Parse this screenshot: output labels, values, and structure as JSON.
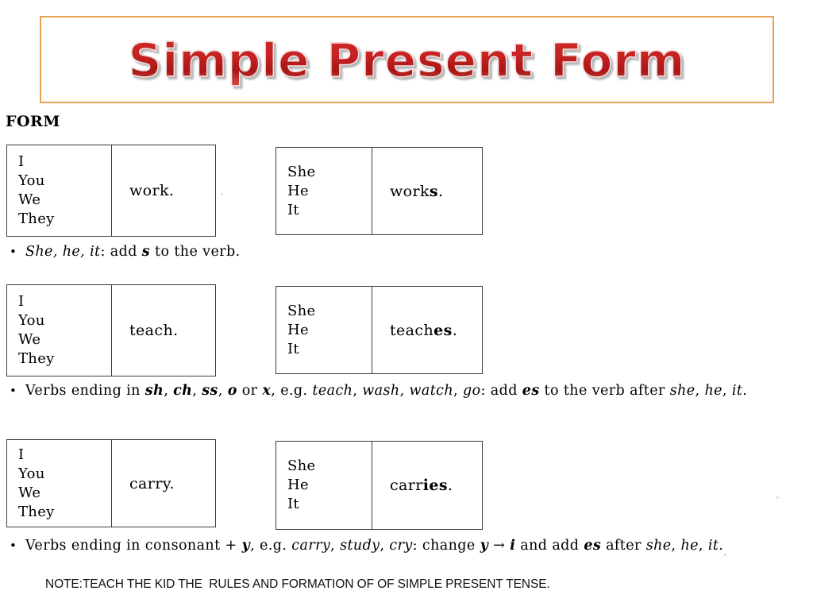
{
  "slide": {
    "title": "Simple Present Form",
    "section_heading": "FORM",
    "accent_border_color": "#e8a055",
    "title_color": "#c62222",
    "background_color": "#ffffff"
  },
  "tables": [
    {
      "left": {
        "pronouns": [
          "I",
          "You",
          "We",
          "They"
        ],
        "verb_stem": "work",
        "verb_inflection": "",
        "verb_period": "."
      },
      "right": {
        "pronouns": [
          "She",
          "He",
          "It"
        ],
        "verb_stem": "work",
        "verb_inflection": "s",
        "verb_period": "."
      }
    },
    {
      "left": {
        "pronouns": [
          "I",
          "You",
          "We",
          "They"
        ],
        "verb_stem": "teach",
        "verb_inflection": "",
        "verb_period": "."
      },
      "right": {
        "pronouns": [
          "She",
          "He",
          "It"
        ],
        "verb_stem": "teach",
        "verb_inflection": "es",
        "verb_period": "."
      }
    },
    {
      "left": {
        "pronouns": [
          "I",
          "You",
          "We",
          "They"
        ],
        "verb_stem": "carry",
        "verb_inflection": "",
        "verb_period": "."
      },
      "right": {
        "pronouns": [
          "She",
          "He",
          "It"
        ],
        "verb_stem": "carr",
        "verb_inflection": "ies",
        "verb_period": "."
      }
    }
  ],
  "rules": [
    {
      "id": "rule-add-s",
      "segments": [
        {
          "text": "She, he, it",
          "style": "italic"
        },
        {
          "text": ": add ",
          "style": "normal"
        },
        {
          "text": "s",
          "style": "bold-italic"
        },
        {
          "text": " to the verb.",
          "style": "normal"
        }
      ]
    },
    {
      "id": "rule-add-es",
      "segments": [
        {
          "text": "Verbs ending in ",
          "style": "normal"
        },
        {
          "text": "sh",
          "style": "bold-italic"
        },
        {
          "text": ", ",
          "style": "normal"
        },
        {
          "text": "ch",
          "style": "bold-italic"
        },
        {
          "text": ", ",
          "style": "normal"
        },
        {
          "text": "ss",
          "style": "bold-italic"
        },
        {
          "text": ", ",
          "style": "normal"
        },
        {
          "text": "o",
          "style": "bold-italic"
        },
        {
          "text": " or ",
          "style": "normal"
        },
        {
          "text": "x",
          "style": "bold-italic"
        },
        {
          "text": ", e.g. ",
          "style": "normal"
        },
        {
          "text": "teach",
          "style": "italic"
        },
        {
          "text": ", ",
          "style": "normal"
        },
        {
          "text": "wash",
          "style": "italic"
        },
        {
          "text": ", ",
          "style": "normal"
        },
        {
          "text": "watch",
          "style": "italic"
        },
        {
          "text": ", ",
          "style": "normal"
        },
        {
          "text": "go",
          "style": "italic"
        },
        {
          "text": ": add ",
          "style": "normal"
        },
        {
          "text": "es",
          "style": "bold-italic"
        },
        {
          "text": " to the verb after ",
          "style": "normal"
        },
        {
          "text": "she",
          "style": "italic"
        },
        {
          "text": ", ",
          "style": "normal"
        },
        {
          "text": "he",
          "style": "italic"
        },
        {
          "text": ", ",
          "style": "normal"
        },
        {
          "text": "it",
          "style": "italic"
        },
        {
          "text": ".",
          "style": "normal"
        }
      ]
    },
    {
      "id": "rule-y-to-i",
      "segments": [
        {
          "text": "Verbs ending in consonant ",
          "style": "normal"
        },
        {
          "text": "+ ",
          "style": "normal"
        },
        {
          "text": "y",
          "style": "bold-italic"
        },
        {
          "text": ", e.g. ",
          "style": "normal"
        },
        {
          "text": "carry",
          "style": "italic"
        },
        {
          "text": ", ",
          "style": "normal"
        },
        {
          "text": "study",
          "style": "italic"
        },
        {
          "text": ", ",
          "style": "normal"
        },
        {
          "text": "cry",
          "style": "italic"
        },
        {
          "text": ": change ",
          "style": "normal"
        },
        {
          "text": "y",
          "style": "bold-italic"
        },
        {
          "text": " → ",
          "style": "normal"
        },
        {
          "text": "i",
          "style": "bold-italic"
        },
        {
          "text": " and add ",
          "style": "normal"
        },
        {
          "text": "es",
          "style": "bold-italic"
        },
        {
          "text": " after ",
          "style": "normal"
        },
        {
          "text": "she",
          "style": "italic"
        },
        {
          "text": ", ",
          "style": "normal"
        },
        {
          "text": "he",
          "style": "italic"
        },
        {
          "text": ", ",
          "style": "normal"
        },
        {
          "text": "it",
          "style": "italic"
        },
        {
          "text": ".",
          "style": "normal"
        }
      ]
    }
  ],
  "footer": {
    "note": "NOTE:TEACH THE KID THE  RULES AND FORMATION OF OF SIMPLE PRESENT TENSE."
  }
}
